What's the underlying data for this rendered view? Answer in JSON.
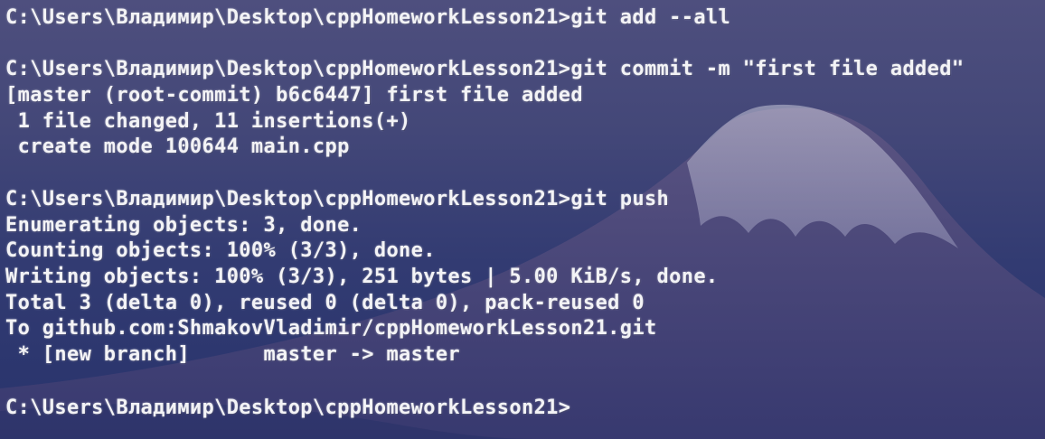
{
  "terminal": {
    "lines": [
      "C:\\Users\\Владимир\\Desktop\\cppHomeworkLesson21>git add --all",
      "",
      "C:\\Users\\Владимир\\Desktop\\cppHomeworkLesson21>git commit -m \"first file added\"",
      "[master (root-commit) b6c6447] first file added",
      " 1 file changed, 11 insertions(+)",
      " create mode 100644 main.cpp",
      "",
      "C:\\Users\\Владимир\\Desktop\\cppHomeworkLesson21>git push",
      "Enumerating objects: 3, done.",
      "Counting objects: 100% (3/3), done.",
      "Writing objects: 100% (3/3), 251 bytes | 5.00 KiB/s, done.",
      "Total 3 (delta 0), reused 0 (delta 0), pack-reused 0",
      "To github.com:ShmakovVladimir/cppHomeworkLesson21.git",
      " * [new branch]      master -> master",
      "",
      "C:\\Users\\Владимир\\Desktop\\cppHomeworkLesson21>"
    ]
  },
  "colors": {
    "text": "#f3f3f6",
    "sky_top": "#4e4f7e",
    "sky_bottom": "#28336c",
    "mountain": "#5a4f78",
    "snow": "#dcdbe8"
  },
  "background": {
    "image_icon": "mountain-fuji-wallpaper-icon"
  }
}
